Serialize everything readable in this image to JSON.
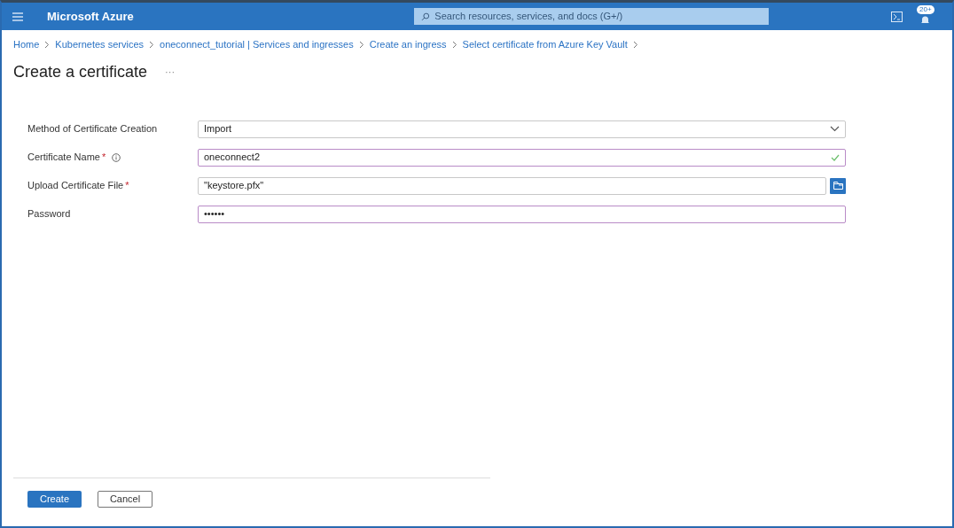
{
  "header": {
    "title": "Microsoft Azure",
    "search_placeholder": "Search resources, services, and docs (G+/)",
    "notification_badge": "20+"
  },
  "breadcrumb": [
    "Home",
    "Kubernetes services",
    "oneconnect_tutorial | Services and ingresses",
    "Create an ingress",
    "Select certificate from Azure Key Vault"
  ],
  "page_title": "Create a certificate",
  "page_menu": "···",
  "fields": [
    {
      "kind": "dropdown",
      "label": "Method of Certificate Creation",
      "info": false,
      "value": "Import",
      "highlighted": false,
      "valid": false
    },
    {
      "kind": "text",
      "label": "Certificate Name",
      "required_mark": "*",
      "info": true,
      "value": "oneconnect2",
      "highlighted": true,
      "valid": true
    },
    {
      "kind": "file",
      "label": "Upload Certificate File",
      "required_mark": "*",
      "info": false,
      "value": "\"keystore.pfx\"",
      "highlighted": false,
      "valid": false
    },
    {
      "kind": "password",
      "label": "Password",
      "info": false,
      "value": "••••••",
      "highlighted": true,
      "valid": false
    }
  ],
  "buttons": [
    {
      "label": "Create",
      "primary": true
    },
    {
      "label": "Cancel",
      "primary": false
    }
  ]
}
